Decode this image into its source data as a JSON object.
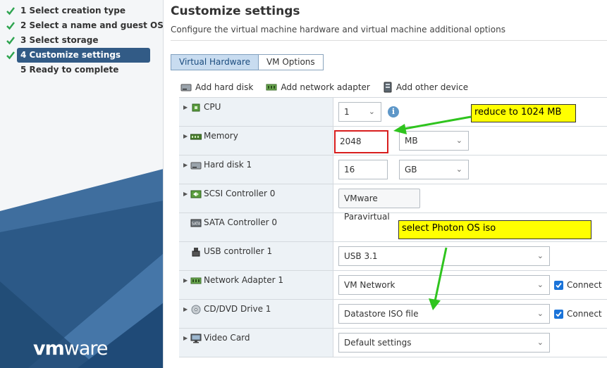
{
  "sidebar": {
    "steps": [
      {
        "label": "1  Select creation type",
        "done": true
      },
      {
        "label": "2  Select a name and guest OS",
        "done": true
      },
      {
        "label": "3  Select storage",
        "done": true
      },
      {
        "label": "4  Customize settings",
        "done": true,
        "active": true
      },
      {
        "label": "5  Ready to complete",
        "done": false
      }
    ],
    "logo": {
      "part1": "vm",
      "part2": "ware"
    }
  },
  "main": {
    "title": "Customize settings",
    "subtitle": "Configure the virtual machine hardware and virtual machine additional options",
    "tabs": [
      {
        "label": "Virtual Hardware",
        "selected": true
      },
      {
        "label": "VM Options",
        "selected": false
      }
    ],
    "toolbar": {
      "add_hard_disk": "Add hard disk",
      "add_network_adapter": "Add network adapter",
      "add_other_device": "Add other device"
    },
    "devices": {
      "cpu": {
        "label": "CPU",
        "value": "1"
      },
      "memory": {
        "label": "Memory",
        "value": "2048",
        "unit": "MB"
      },
      "hard_disk": {
        "label": "Hard disk 1",
        "value": "16",
        "unit": "GB"
      },
      "scsi": {
        "label": "SCSI Controller 0",
        "value": "VMware Paravirtual"
      },
      "sata": {
        "label": "SATA Controller 0"
      },
      "usb": {
        "label": "USB controller 1",
        "value": "USB 3.1"
      },
      "network": {
        "label": "Network Adapter 1",
        "value": "VM Network",
        "connect_label": "Connect",
        "connected": true
      },
      "cdrom": {
        "label": "CD/DVD Drive 1",
        "value": "Datastore ISO file",
        "connect_label": "Connect",
        "connected": true
      },
      "video": {
        "label": "Video Card",
        "value": "Default settings"
      }
    }
  },
  "annotations": {
    "note1": "reduce to 1024 MB",
    "note2": "select Photon OS iso"
  },
  "colors": {
    "active_step": "#325b86",
    "check": "#2ea44f",
    "accent": "#1a73d9",
    "highlight": "#ffff00",
    "arrow": "#2fc41e",
    "focus_border": "#d81e1e"
  }
}
